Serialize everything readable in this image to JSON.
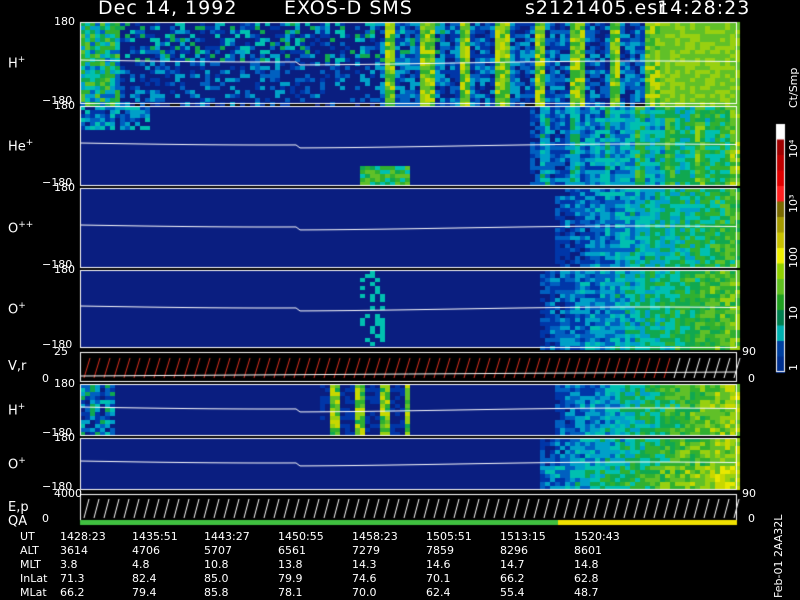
{
  "header": {
    "date": "Dec 14, 1992",
    "instrument": "EXOS-D SMS",
    "file": "s2121405.esr",
    "time": "14:28:23"
  },
  "panels": [
    {
      "id": "hp1",
      "label": "H",
      "sup": "+",
      "top": "180",
      "bottom": "−180"
    },
    {
      "id": "hep",
      "label": "He",
      "sup": "+",
      "top": "180",
      "bottom": "−180"
    },
    {
      "id": "opp",
      "label": "O",
      "sup": "++",
      "top": "180",
      "bottom": "−180"
    },
    {
      "id": "op1",
      "label": "O",
      "sup": "+",
      "top": "180",
      "bottom": "−180"
    },
    {
      "id": "vr",
      "label": "V,r",
      "top": "25",
      "bottom": "0",
      "right_top": "90",
      "right_bottom": "0"
    },
    {
      "id": "hp2",
      "label": "H",
      "sup": "+",
      "top": "180",
      "bottom": "−180"
    },
    {
      "id": "op2",
      "label": "O",
      "sup": "+",
      "top": "180",
      "bottom": "−180"
    },
    {
      "id": "ep",
      "label": "E,p",
      "label2": "QA",
      "top": "4000",
      "bottom": "0",
      "right_top": "90",
      "right_bottom": "0"
    }
  ],
  "colorbar": {
    "unit": "Ct/Smp",
    "ticks": [
      "10⁴",
      "10³",
      "100",
      "10",
      "1"
    ],
    "colors": [
      "#ffffff",
      "#a00000",
      "#c00000",
      "#e00000",
      "#ff2020",
      "#7a6a00",
      "#a59a00",
      "#c8c000",
      "#f0f000",
      "#90d000",
      "#60c020",
      "#20a020",
      "#008050",
      "#00b0b0",
      "#0040a0",
      "#003090"
    ]
  },
  "chart_data": {
    "type": "heatmap",
    "title": "Dec 14, 1992   EXOS-D SMS",
    "time_labels": [
      "1428:23",
      "1435:51",
      "1443:27",
      "1450:55",
      "1458:23",
      "1505:51",
      "1513:15",
      "1520:43"
    ],
    "orbit_table": {
      "rows": [
        {
          "name": "UT",
          "values": [
            "1428:23",
            "1435:51",
            "1443:27",
            "1450:55",
            "1458:23",
            "1505:51",
            "1513:15",
            "1520:43"
          ]
        },
        {
          "name": "ALT",
          "values": [
            "3614",
            "4706",
            "5707",
            "6561",
            "7279",
            "7859",
            "8296",
            "8601"
          ]
        },
        {
          "name": "MLT",
          "values": [
            "3.8",
            "4.8",
            "10.8",
            "13.8",
            "14.3",
            "14.6",
            "14.7",
            "14.8"
          ]
        },
        {
          "name": "InLat",
          "values": [
            "71.3",
            "82.4",
            "85.0",
            "79.9",
            "74.6",
            "70.1",
            "66.2",
            "62.8"
          ]
        },
        {
          "name": "MLat",
          "values": [
            "66.2",
            "79.4",
            "85.8",
            "78.1",
            "70.0",
            "62.4",
            "55.4",
            "48.7"
          ]
        }
      ]
    },
    "y_range": [
      -180,
      180
    ],
    "color_scale": "log",
    "color_range": [
      1,
      10000
    ]
  },
  "footer": {
    "stamp": "Feb-01 2AA32L"
  }
}
